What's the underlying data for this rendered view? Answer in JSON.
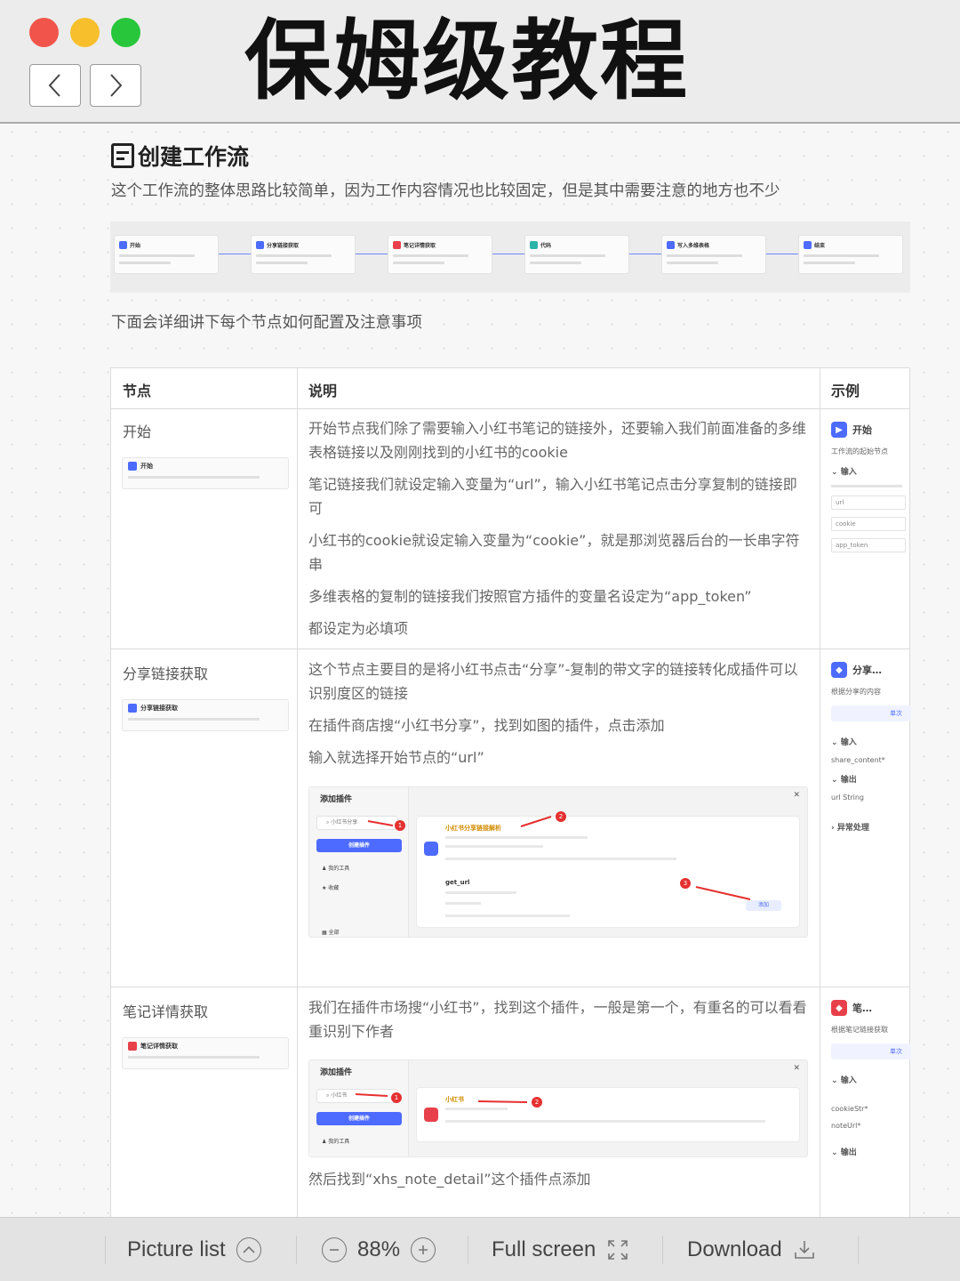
{
  "window": {
    "title": "保姆级教程"
  },
  "doc": {
    "heading": "创建工作流",
    "intro": "这个工作流的整体思路比较简单，因为工作内容情况也比较固定，但是其中需要注意的地方也不少",
    "sub_intro": "下面会详细讲下每个节点如何配置及注意事项",
    "flow_nodes": [
      "开始",
      "分享链接获取",
      "笔记详情获取",
      "代码",
      "写入多维表格",
      "结束"
    ],
    "table": {
      "headers": [
        "节点",
        "说明",
        "示例"
      ],
      "rows": [
        {
          "node": "开始",
          "mini_label": "开始",
          "desc": [
            "开始节点我们除了需要输入小红书笔记的链接外，还要输入我们前面准备的多维表格链接以及刚刚找到的小红书的cookie",
            "笔记链接我们就设定输入变量为“url”，输入小红书笔记点击分享复制的链接即可",
            "小红书的cookie就设定输入变量为“cookie”，就是那浏览器后台的一长串字符串",
            "多维表格的复制的链接我们按照官方插件的变量名设定为“app_token”",
            "都设定为必填项"
          ],
          "example": {
            "title": "开始",
            "sub": "工作流的起始节点",
            "label": "输入",
            "fields": [
              "url",
              "cookie",
              "app_token"
            ]
          }
        },
        {
          "node": "分享链接获取",
          "mini_label": "分享链接获取",
          "desc": [
            "这个节点主要目的是将小红书点击“分享”-复制的带文字的链接转化成插件可以识别度区的链接",
            "在插件商店搜“小红书分享”，找到如图的插件，点击添加",
            "输入就选择开始节点的“url”"
          ],
          "plugin": {
            "title": "添加插件",
            "search": "小红书分享",
            "create_btn": "创建插件",
            "side_items": [
              "我的工具",
              "收藏",
              "全部"
            ],
            "card1_name": "小红书分享链接解析",
            "card2_name": "get_url",
            "add_label": "添加"
          },
          "example": {
            "title": "分享…",
            "sub": "根据分享的内容",
            "pill": "单次",
            "label_in": "输入",
            "field_in": "share_content*",
            "label_out": "输出",
            "field_out": "url String",
            "label_err": "异常处理"
          }
        },
        {
          "node": "笔记详情获取",
          "mini_label": "笔记详情获取",
          "desc": [
            "我们在插件市场搜“小红书”，找到这个插件，一般是第一个，有重名的可以看看重识别下作者",
            "然后找到“xhs_note_detail”这个插件点添加"
          ],
          "plugin": {
            "title": "添加插件",
            "search": "小红书",
            "create_btn": "创建插件",
            "side_items": [
              "我的工具"
            ],
            "card1_name": "小红书"
          },
          "example": {
            "title": "笔…",
            "sub": "根据笔记链接获取",
            "pill": "单次",
            "label_in": "输入",
            "fields": [
              "cookieStr*",
              "noteUrl*"
            ],
            "label_out": "输出"
          }
        }
      ]
    }
  },
  "toolbar": {
    "picture_list": "Picture list",
    "zoom": "88%",
    "full_screen": "Full screen",
    "download": "Download"
  },
  "colors": {
    "accent": "#4d6bfe",
    "red_light": "#f1544a",
    "yellow_light": "#f8bf2c",
    "green_light": "#28c63b"
  }
}
